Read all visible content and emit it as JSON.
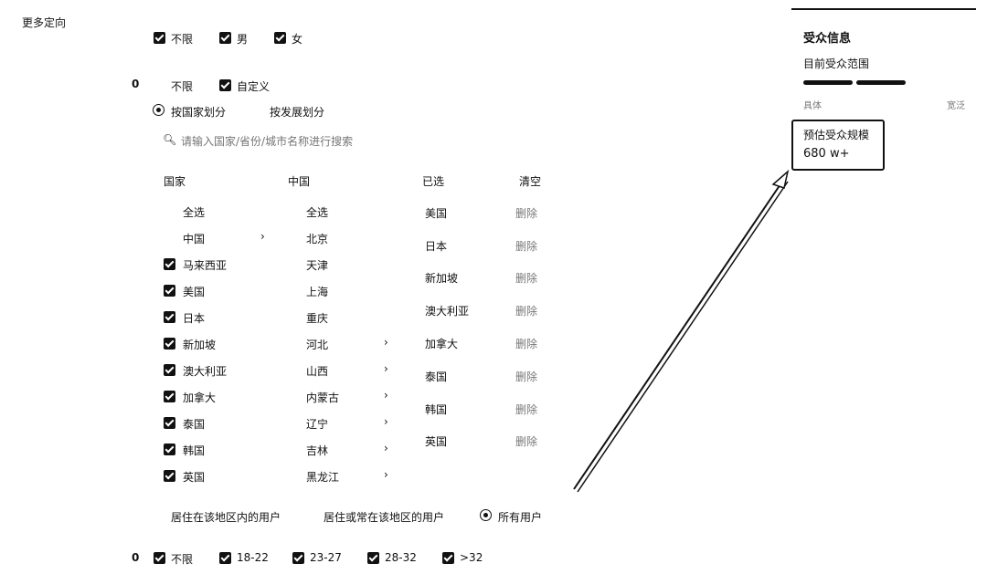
{
  "section_label": "更多定向",
  "gender": {
    "options": [
      "不限",
      "男",
      "女"
    ]
  },
  "region": {
    "indicator": "0",
    "mode_options": [
      "不限",
      "自定义"
    ],
    "split_options": [
      "按国家划分",
      "按发展划分"
    ],
    "search_placeholder": "请输入国家/省份/城市名称进行搜索",
    "countries": {
      "header": "国家",
      "items": [
        "全选",
        "中国",
        "马来西亚",
        "美国",
        "日本",
        "新加坡",
        "澳大利亚",
        "加拿大",
        "泰国",
        "韩国",
        "英国"
      ]
    },
    "provinces": {
      "header": "中国",
      "items": [
        "全选",
        "北京",
        "天津",
        "上海",
        "重庆",
        "河北",
        "山西",
        "内蒙古",
        "辽宁",
        "吉林",
        "黑龙江"
      ]
    },
    "selected": {
      "header": "已选",
      "clear_label": "清空",
      "remove_label": "删除",
      "items": [
        "美国",
        "日本",
        "新加坡",
        "澳大利亚",
        "加拿大",
        "泰国",
        "韩国",
        "英国"
      ]
    },
    "user_scope": [
      "居住在该地区内的用户",
      "居住或常在该地区的用户",
      "所有用户"
    ]
  },
  "age": {
    "indicator": "0",
    "options": [
      "不限",
      "18-22",
      "23-27",
      "28-32",
      ">32"
    ]
  },
  "audience_panel": {
    "title": "受众信息",
    "subtitle": "目前受众范围",
    "range_left": "具体",
    "range_right": "宽泛",
    "estimate_label": "预估受众规模",
    "estimate_value": "680 w+"
  }
}
